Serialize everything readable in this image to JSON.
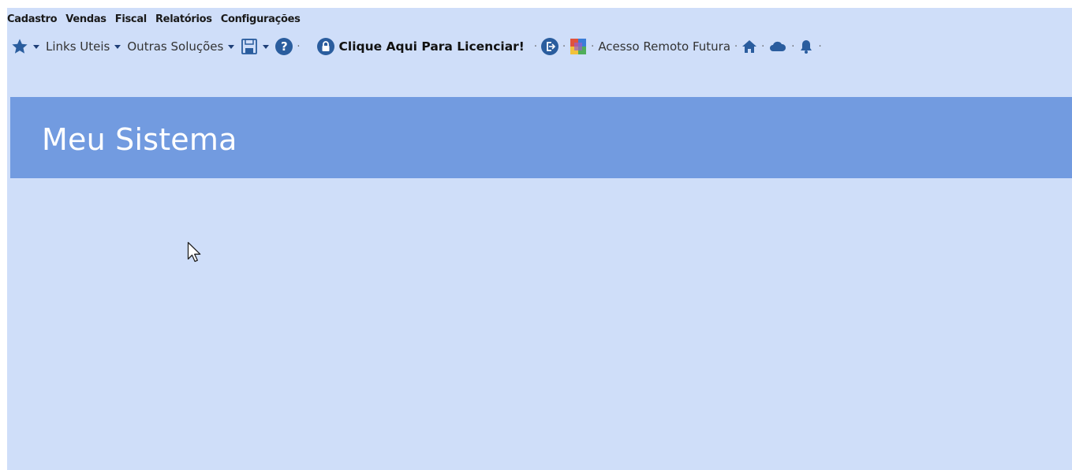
{
  "menubar": {
    "items": [
      {
        "label": "Cadastro"
      },
      {
        "label": "Vendas"
      },
      {
        "label": "Fiscal"
      },
      {
        "label": "Relatórios"
      },
      {
        "label": "Configurações"
      }
    ]
  },
  "toolbar": {
    "favorites_icon": "star-icon",
    "links_uteis": "Links Uteis",
    "outras_solucoes": "Outras Soluções",
    "save_icon": "floppy-disk-icon",
    "help_glyph": "?",
    "licenciar_label": "Clique Aqui Para Licenciar!",
    "acesso_remoto": "Acesso Remoto Futura",
    "separator": "·"
  },
  "header": {
    "title": "Meu Sistema"
  },
  "colors": {
    "window_background": "#cfdef9",
    "header_background": "#729be0",
    "icon_blue": "#2a5d9e"
  }
}
